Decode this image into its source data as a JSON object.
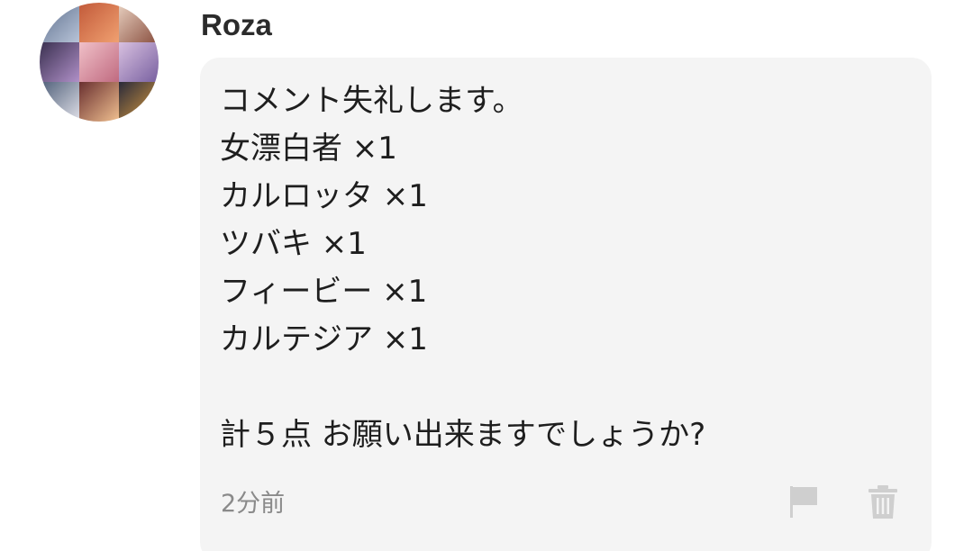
{
  "comment": {
    "author": "Roza",
    "lines": [
      "コメント失礼します。",
      "女漂白者 ×1",
      "カルロッタ ×1",
      "ツバキ ×1",
      "フィービー ×1",
      "カルテジア ×1",
      "",
      "計５点 お願い出来ますでしょうか?"
    ],
    "timestamp": "2分前"
  },
  "icons": {
    "avatar": "avatar-image",
    "report": "flag-icon",
    "delete": "trash-icon"
  },
  "colors": {
    "bubble": "#f4f4f4",
    "icon": "#cfcfcf",
    "text": "#1e1e1e",
    "muted": "#8a8a8a"
  }
}
